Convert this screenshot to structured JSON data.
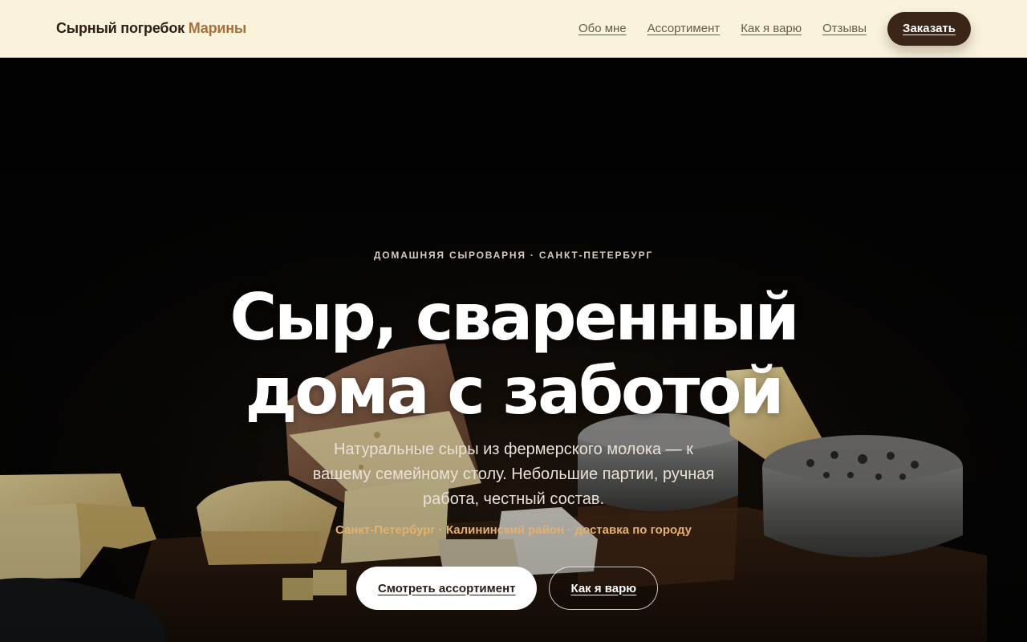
{
  "header": {
    "brand_main": "Сырный погребок",
    "brand_accent": "Марины",
    "nav": [
      {
        "label": "Обо мне"
      },
      {
        "label": "Ассортимент"
      },
      {
        "label": "Как я варю"
      },
      {
        "label": "Отзывы"
      }
    ],
    "order_label": "Заказать"
  },
  "hero": {
    "kicker": "ДОМАШНЯЯ СЫРОВАРНЯ · САНКТ-ПЕТЕРБУРГ",
    "headline_line1": "Сыр, сваренный",
    "headline_line2": "дома с заботой",
    "subtitle": "Натуральные сыры из фермерского молока — к вашему семейному столу. Небольшие партии, ручная работа, честный состав.",
    "location": "Санкт-Петербург · Калининский район · доставка по городу",
    "primary_cta": "Смотреть ассортимент",
    "secondary_cta": "Как я варю"
  },
  "colors": {
    "header_bg": "#faf3dc",
    "brand_text": "#2f2117",
    "brand_accent": "#a8703f",
    "order_button": "#3a2518",
    "location_text": "#e3b06e"
  }
}
